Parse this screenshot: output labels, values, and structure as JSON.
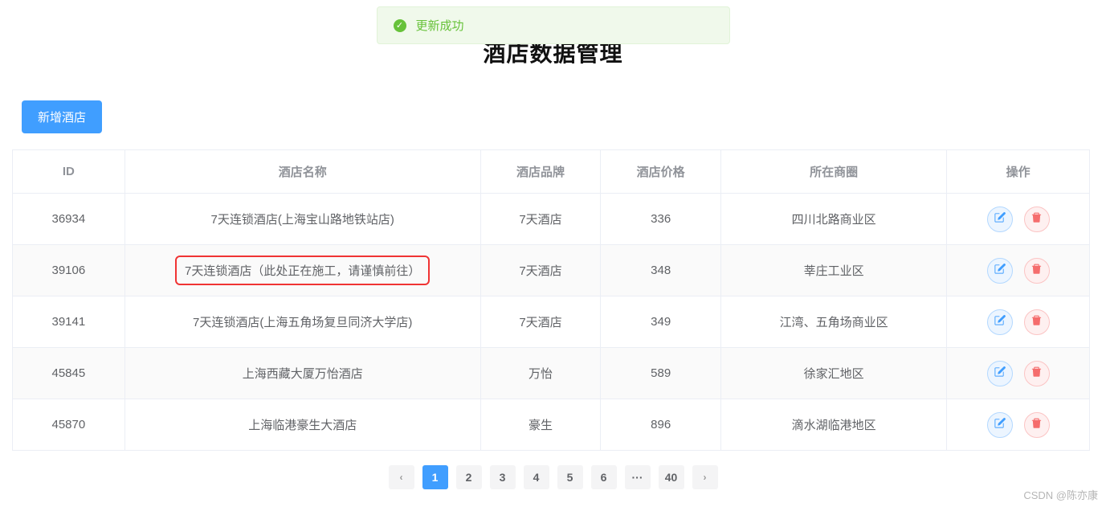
{
  "toast": {
    "message": "更新成功"
  },
  "page_title": "酒店数据管理",
  "add_button_label": "新增酒店",
  "columns": {
    "id": "ID",
    "name": "酒店名称",
    "brand": "酒店品牌",
    "price": "酒店价格",
    "area": "所在商圈",
    "op": "操作"
  },
  "rows": [
    {
      "id": "36934",
      "name": "7天连锁酒店(上海宝山路地铁站店)",
      "brand": "7天酒店",
      "price": "336",
      "area": "四川北路商业区",
      "stripe": false,
      "highlight": false
    },
    {
      "id": "39106",
      "name": "7天连锁酒店（此处正在施工，请谨慎前往）",
      "brand": "7天酒店",
      "price": "348",
      "area": "莘庄工业区",
      "stripe": true,
      "highlight": true
    },
    {
      "id": "39141",
      "name": "7天连锁酒店(上海五角场复旦同济大学店)",
      "brand": "7天酒店",
      "price": "349",
      "area": "江湾、五角场商业区",
      "stripe": false,
      "highlight": false
    },
    {
      "id": "45845",
      "name": "上海西藏大厦万怡酒店",
      "brand": "万怡",
      "price": "589",
      "area": "徐家汇地区",
      "stripe": true,
      "highlight": false
    },
    {
      "id": "45870",
      "name": "上海临港豪生大酒店",
      "brand": "豪生",
      "price": "896",
      "area": "滴水湖临港地区",
      "stripe": false,
      "highlight": false
    }
  ],
  "pagination": {
    "prev": "‹",
    "next": "›",
    "ellipsis": "···",
    "pages": [
      "1",
      "2",
      "3",
      "4",
      "5",
      "6"
    ],
    "last": "40",
    "active": "1"
  },
  "watermark": "CSDN @陈亦康"
}
